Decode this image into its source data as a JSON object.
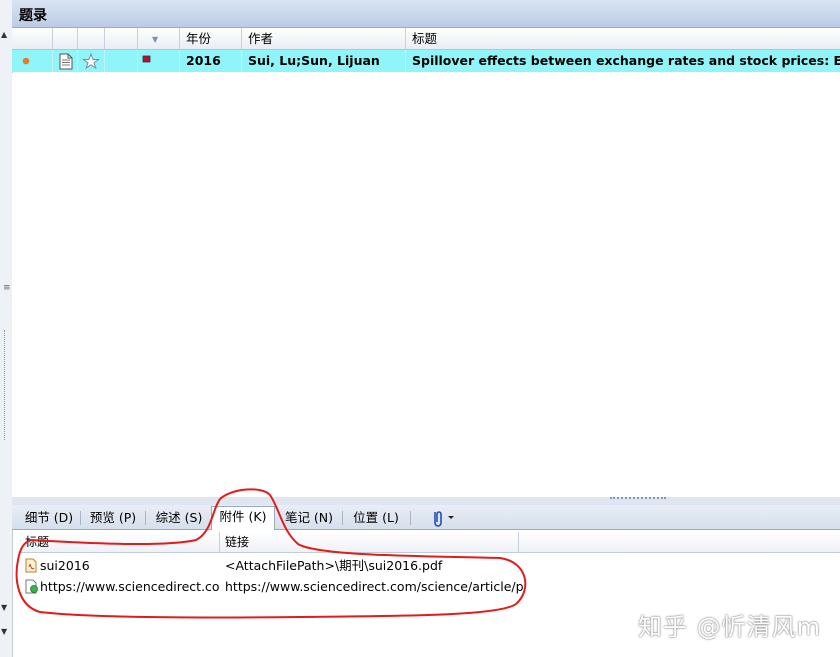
{
  "panel": {
    "title": "题录"
  },
  "columns": {
    "year": "年份",
    "author": "作者",
    "title": "标题",
    "sort_indicator": "▼"
  },
  "reference": {
    "year": "2016",
    "author": "Sui, Lu;Sun, Lijuan",
    "title": "Spillover effects between exchange rates and stock prices: Evide"
  },
  "tabs": [
    {
      "label": "细节 (D)",
      "active": false
    },
    {
      "label": "预览 (P)",
      "active": false
    },
    {
      "label": "综述 (S)",
      "active": false
    },
    {
      "label": "附件 (K)",
      "active": true
    },
    {
      "label": "笔记 (N)",
      "active": false
    },
    {
      "label": "位置 (L)",
      "active": false
    }
  ],
  "attachments": {
    "header": {
      "title": "标题",
      "link": "链接"
    },
    "rows": [
      {
        "title": "sui2016",
        "link": "<AttachFilePath>\\期刊\\sui2016.pdf",
        "icon": "pdf-file-icon"
      },
      {
        "title": "https://www.sciencedirect.co...",
        "link": "https://www.sciencedirect.com/science/article/p...",
        "icon": "web-link-icon"
      }
    ]
  },
  "watermark": "知乎 @忻清风m",
  "colors": {
    "selected_row": "#8ff5f9",
    "unread_dot": "#e8792a",
    "flag": "#b0103a",
    "annotation_red": "#e21b1b",
    "clip_blue": "#1f4fc2"
  }
}
